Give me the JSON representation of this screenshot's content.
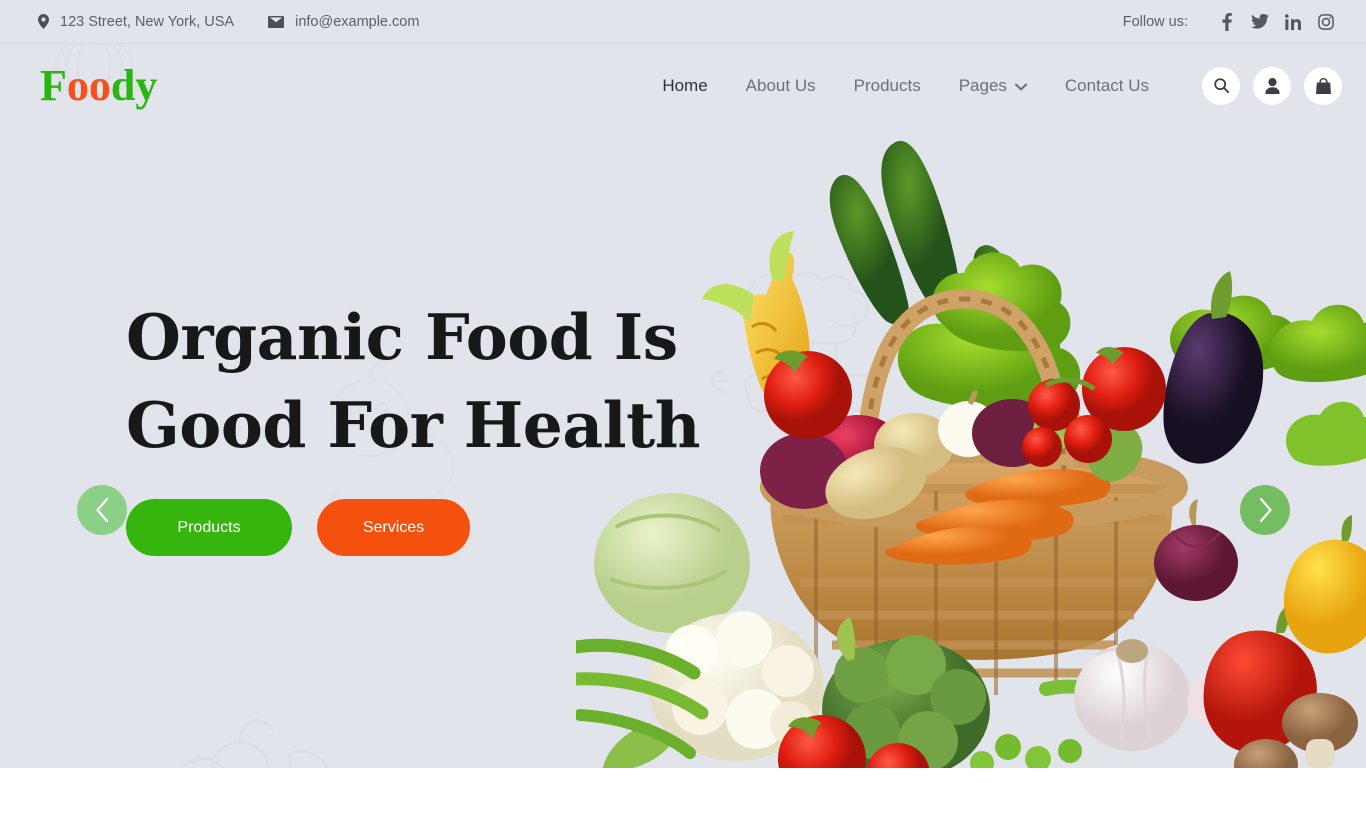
{
  "topbar": {
    "address": "123 Street, New York, USA",
    "email": "info@example.com",
    "follow_label": "Follow us:",
    "socials": [
      {
        "name": "facebook-icon",
        "label": "Facebook"
      },
      {
        "name": "twitter-icon",
        "label": "Twitter"
      },
      {
        "name": "linkedin-icon",
        "label": "LinkedIn"
      },
      {
        "name": "instagram-icon",
        "label": "Instagram"
      }
    ]
  },
  "header": {
    "logo": {
      "part1": "F",
      "part2": "oo",
      "part3": "dy",
      "full": "Foody"
    },
    "nav": [
      {
        "label": "Home",
        "active": true
      },
      {
        "label": "About Us",
        "active": false
      },
      {
        "label": "Products",
        "active": false
      },
      {
        "label": "Pages",
        "active": false,
        "has_dropdown": true
      },
      {
        "label": "Contact Us",
        "active": false
      }
    ],
    "actions": [
      {
        "name": "search-icon",
        "label": "Search"
      },
      {
        "name": "user-icon",
        "label": "Account"
      },
      {
        "name": "shopping-bag-icon",
        "label": "Cart"
      }
    ]
  },
  "hero": {
    "title_line1": "Organic Food Is",
    "title_line2": "Good For Health",
    "buttons": [
      {
        "label": "Products",
        "color": "#36b50e"
      },
      {
        "label": "Services",
        "color": "#f4510e"
      }
    ],
    "carousel": {
      "prev_label": "Previous slide",
      "next_label": "Next slide"
    }
  },
  "colors": {
    "page_bg": "#e1e5eb",
    "logo_green": "#2bb510",
    "logo_orange": "#f4511e",
    "btn_green": "#36b50e",
    "btn_orange": "#f4510e",
    "arrow_green": "#8ccf86",
    "text_dark": "#181818",
    "text_muted": "#6c7077"
  }
}
